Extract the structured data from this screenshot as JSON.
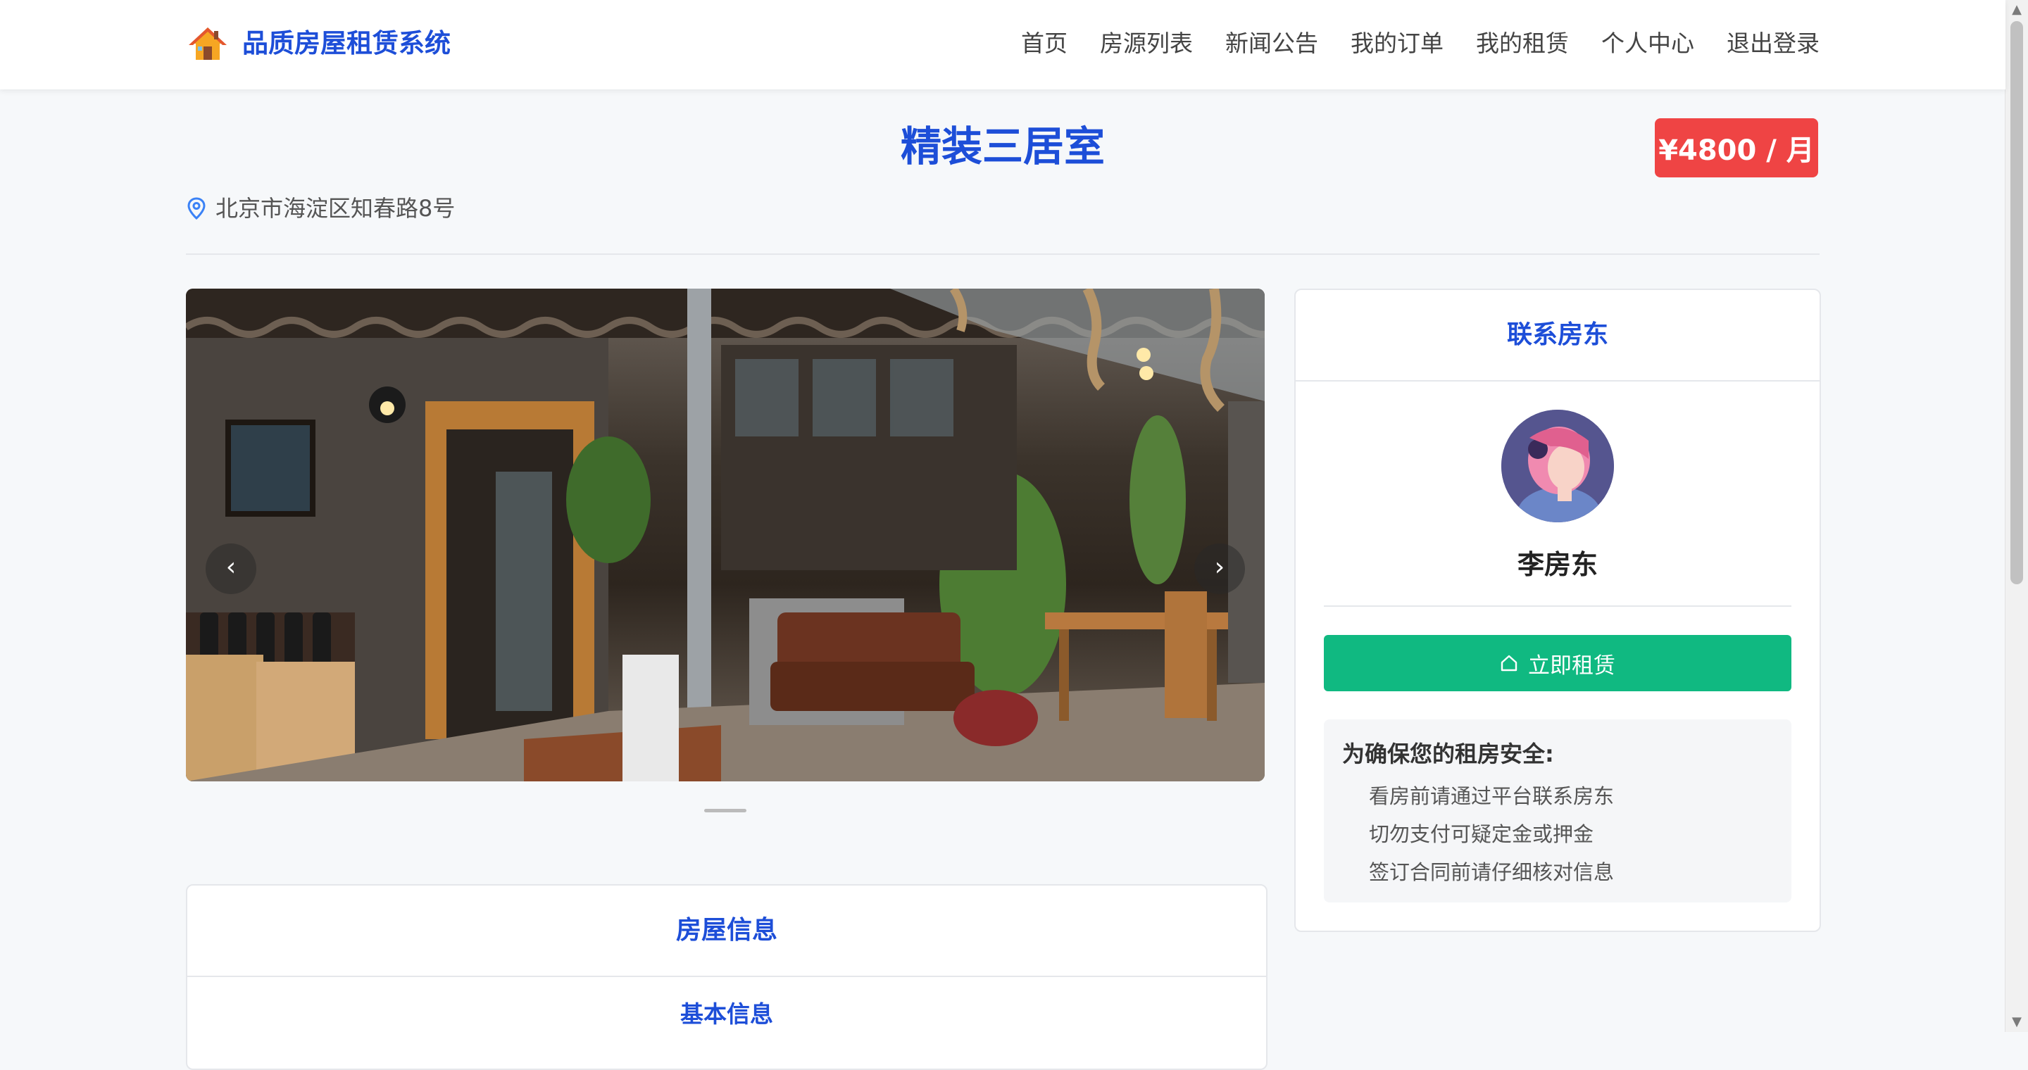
{
  "header": {
    "brand": "品质房屋租赁系统",
    "nav": [
      "首页",
      "房源列表",
      "新闻公告",
      "我的订单",
      "我的租赁",
      "个人中心",
      "退出登录"
    ]
  },
  "house": {
    "title": "精装三居室",
    "price": "¥4800 / 月",
    "address": "北京市海淀区知春路8号"
  },
  "carousel": {
    "prev": "‹",
    "next": "›",
    "image_alt": "courtyard-room-photo"
  },
  "landlord_card": {
    "title": "联系房东",
    "name": "李房东",
    "rent_button": "立即租赁",
    "safety_title": "为确保您的租房安全:",
    "safety_items": [
      "看房前请通过平台联系房东",
      "切勿支付可疑定金或押金",
      "签订合同前请仔细核对信息"
    ]
  },
  "info_card": {
    "title": "房屋信息",
    "subtitle": "基本信息"
  },
  "colors": {
    "brand_blue": "#1d4ed8",
    "price_red": "#ef4444",
    "rent_green": "#10b981"
  }
}
